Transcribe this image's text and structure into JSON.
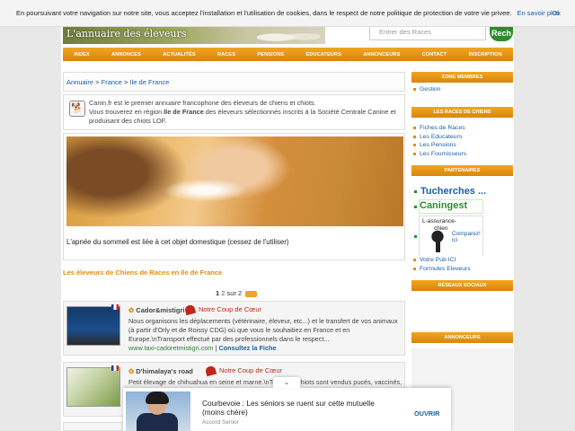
{
  "cookie": {
    "text": "En poursuivant votre navigation sur notre site, vous acceptez l'installation et l'utilisation de cookies, dans le respect de notre politique de protection de votre vie privee.",
    "more_link": "En savoir plus",
    "ok_label": "Ok"
  },
  "header": {
    "banner_title": "L'annuaire des éleveurs",
    "search_placeholder": "Entrer des Races",
    "search_button": "Rech"
  },
  "nav": [
    "INDEX",
    "ANNONCES",
    "ACTUALITÉS",
    "RACES",
    "PENSIONS",
    "EDUCATEURS",
    "ANNONCEURS",
    "CONTACT",
    "INSCRIPTION"
  ],
  "breadcrumb": {
    "l1": "Annuaire",
    "sep": ">",
    "l2": "France",
    "l3": "Ile de France"
  },
  "intro": {
    "line1": "Canin.fr est le premier annuaire francophone des éleveurs de chiens et chiots.",
    "line2a": "Vous trouverez en région ",
    "region": "Ile de France",
    "line2b": " des éleveurs sélectionnés inscrits à la Société Centrale Canine et",
    "line3": "produisant des chiots LOF."
  },
  "ad": {
    "caption": "L'apnée du sommeil est liée à cet objet domestique (cessez de l'utiliser)"
  },
  "section_title": "Les éleveurs de Chiens de Races en Ile de France",
  "pager": {
    "current": "1",
    "next": "2",
    "sur": "sur 2"
  },
  "listings": [
    {
      "name": "Cador&mistigri",
      "badge": "Notre Coup de Cœur",
      "desc": "Nous organisons les déplacements (vétérinaire, éleveur, etc...) et le transfert de vos animaux (à partir d'Orly et de Roissy CDG) où que vous le souhaitiez en France et en Europe.\\nTransport effectué par des professionnels dans le respect...",
      "url": "www.taxi-cadoretmistigri.com",
      "sep": "|",
      "link": "Consultez la Fiche"
    },
    {
      "name": "D'himalaya's road",
      "badge": "Notre Coup de Cœur",
      "desc": "Petit élevage de chihuahua en seine et marne.\\nTous nos chiots sont vendus pucés, vaccinés, (",
      "url": "",
      "sep": "",
      "link": ""
    }
  ],
  "sidebar": {
    "zone_title": "ZONE MEMBRES",
    "zone_items": [
      "Gestion"
    ],
    "races_title": "LES RACES DE CHIENS",
    "races_items": [
      "Fiches de Races",
      "Les Educateurs",
      "Les Pensions",
      "Les Fournisseurs"
    ],
    "partners_title": "PARTENAIRES",
    "tucherches": "Tucherches ...",
    "caningest": "Caningest",
    "assurance_line1": "L-assurance-",
    "assurance_line2": "chien",
    "assurance_cta": "Comparez! ici",
    "partner_links": [
      "Votre Pub ICI",
      "Formules Eleveurs"
    ],
    "social_title": "RÉSEAUX SOCIAUX",
    "annonceurs_title": "ANNONCEURS"
  },
  "popup": {
    "title": "Courbevoie : Les séniors se ruent sur cette mutuelle",
    "title2": "(moins chère)",
    "source": "Accord Senior",
    "cta": "OUVRIR",
    "toggle": "⌄"
  }
}
